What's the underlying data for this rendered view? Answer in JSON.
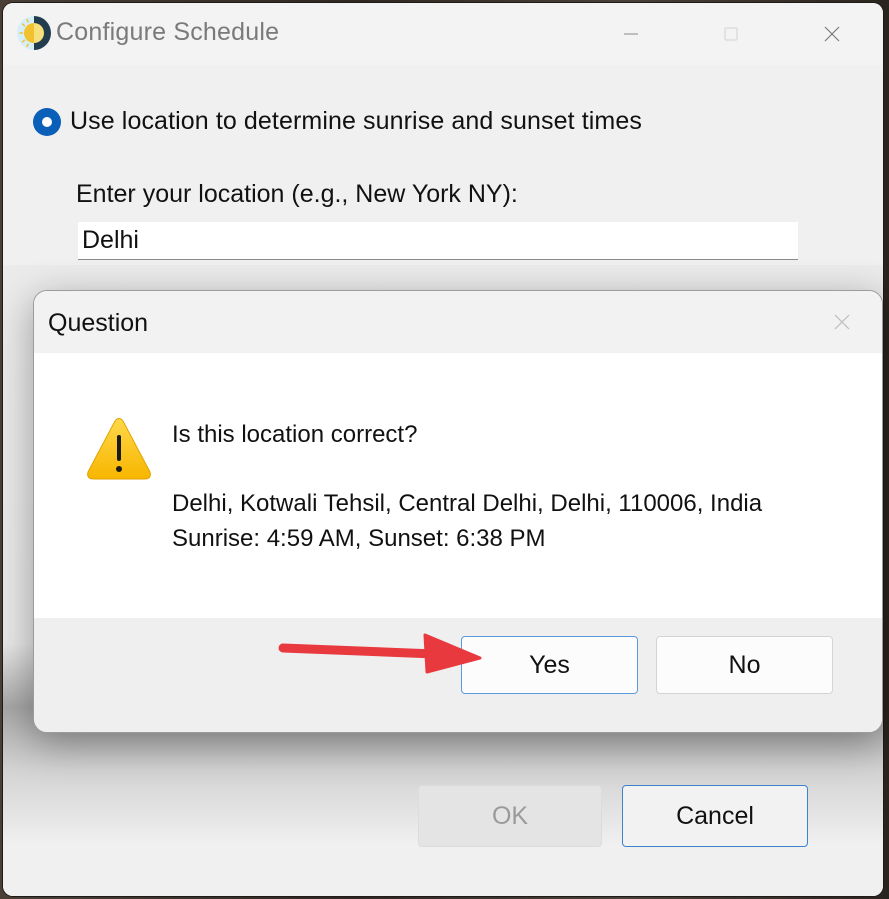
{
  "window": {
    "title": "Configure Schedule",
    "icon": "sun-moon-icon",
    "controls": {
      "minimize": "minimize-icon",
      "maximize": "maximize-icon",
      "close": "close-icon"
    }
  },
  "main": {
    "radio_option": {
      "label": "Use location to determine sunrise and sunset times",
      "selected": true
    },
    "location_label": "Enter your location (e.g., New York NY):",
    "location_input": {
      "value": "Delhi",
      "placeholder": ""
    },
    "buttons": {
      "ok": "OK",
      "cancel": "Cancel"
    },
    "ok_enabled": false
  },
  "dialog": {
    "title": "Question",
    "icon": "warning-icon",
    "question": "Is this location correct?",
    "address": "Delhi, Kotwali Tehsil, Central Delhi, Delhi, 110006, India",
    "sun_times": "Sunrise: 4:59 AM, Sunset: 6:38 PM",
    "buttons": {
      "yes": "Yes",
      "no": "No"
    }
  },
  "annotation": {
    "type": "arrow",
    "color": "#e8393e",
    "points_to": "yes-button"
  },
  "colors": {
    "accent": "#0a5fb8",
    "focus_border": "#3a84cf",
    "warning": "#f7b600"
  }
}
